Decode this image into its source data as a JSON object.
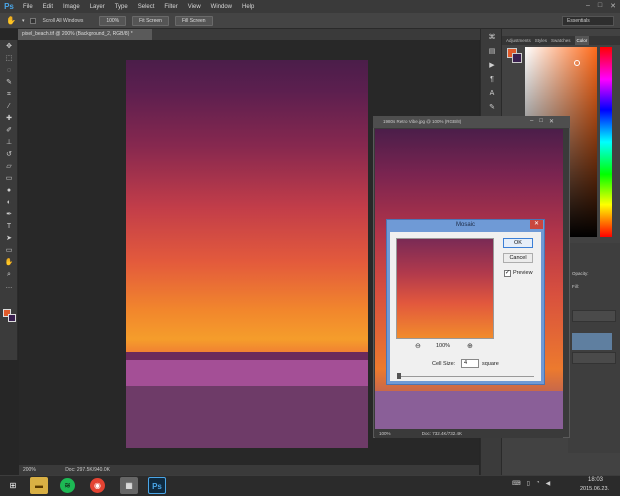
{
  "app": {
    "logo": "Ps"
  },
  "menu": [
    "File",
    "Edit",
    "Image",
    "Layer",
    "Type",
    "Select",
    "Filter",
    "View",
    "Window",
    "Help"
  ],
  "window_controls": [
    "–",
    "□",
    "✕"
  ],
  "options": {
    "scroll_all": "Scroll All Windows",
    "zoom100": "100%",
    "fit_screen": "Fit Screen",
    "fill_screen": "Fill Screen",
    "workspace": "Essentials"
  },
  "document": {
    "tab": "pixel_beach.tif @ 200% (Background_2, RGB/8) *",
    "status_zoom": "200%",
    "status_doc": "Doc: 297.5K/940.0K"
  },
  "panels": {
    "tabs": [
      "Adjustments",
      "Styles",
      "Swatches",
      "Color"
    ],
    "active_tab": "Color",
    "layer_labels": [
      "Opacity:",
      "Fill:"
    ]
  },
  "float_window": {
    "title": "1980s Retro Vibe.jpg @ 100% (RGB/8)",
    "zoom": "100%",
    "doc": "Doc: 732.4K/732.4K"
  },
  "dialog": {
    "title": "Mosaic",
    "close": "✕",
    "ok": "OK",
    "cancel": "Cancel",
    "preview_label": "Preview",
    "preview_checked": "✓",
    "zoom": "100%",
    "cell_size_label": "Cell Size:",
    "cell_size_value": "4",
    "cell_size_unit": "square"
  },
  "taskbar": {
    "time": "18:03",
    "date": "2015.06.23."
  },
  "colors": {
    "foreground": "#e05a2a",
    "background": "#3a2050",
    "ps_blue": "#4aa6e8"
  }
}
